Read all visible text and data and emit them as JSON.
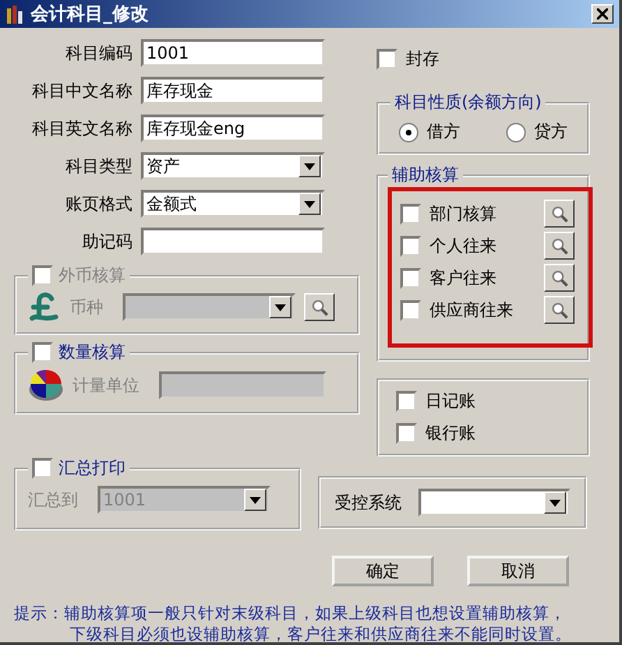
{
  "window": {
    "title": "会计科目_修改"
  },
  "fields": [
    {
      "label": "科目编码",
      "kind": "text",
      "value": "1001"
    },
    {
      "label": "科目中文名称",
      "kind": "text",
      "value": "库存现金"
    },
    {
      "label": "科目英文名称",
      "kind": "text",
      "value": "库存现金eng"
    },
    {
      "label": "科目类型",
      "kind": "dropdown",
      "value": "资产"
    },
    {
      "label": "账页格式",
      "kind": "dropdown",
      "value": "金额式"
    },
    {
      "label": "助记码",
      "kind": "text"
    }
  ],
  "foreign_currency": {
    "label": "外币核算",
    "checked": false,
    "disabled": true,
    "field_label": "币种"
  },
  "quantity": {
    "label": "数量核算",
    "checked": false,
    "field_label": "计量单位"
  },
  "sealed": {
    "label": "封存",
    "checked": false
  },
  "balance_direction": {
    "title": "科目性质(余额方向)",
    "options": [
      {
        "label": "借方",
        "selected": true
      },
      {
        "label": "贷方",
        "selected": false
      }
    ]
  },
  "auxiliary": {
    "title": "辅助核算",
    "items": [
      {
        "label": "部门核算",
        "checked": false
      },
      {
        "label": "个人往来",
        "checked": false
      },
      {
        "label": "客户往来",
        "checked": false
      },
      {
        "label": "供应商往来",
        "checked": false
      }
    ]
  },
  "ledgers": [
    {
      "label": "日记账",
      "checked": false
    },
    {
      "label": "银行账",
      "checked": false
    }
  ],
  "summary_print": {
    "label": "汇总打印",
    "checked": false,
    "field_label": "汇总到",
    "value": "1001"
  },
  "controlled_system": {
    "label": "受控系统"
  },
  "buttons": [
    "确定",
    "取消"
  ],
  "hint": [
    "提示：辅助核算项一般只针对末级科目，如果上级科目也想设置辅助核算，",
    "下级科目必须也设辅助核算，客户往来和供应商往来不能同时设置。"
  ]
}
